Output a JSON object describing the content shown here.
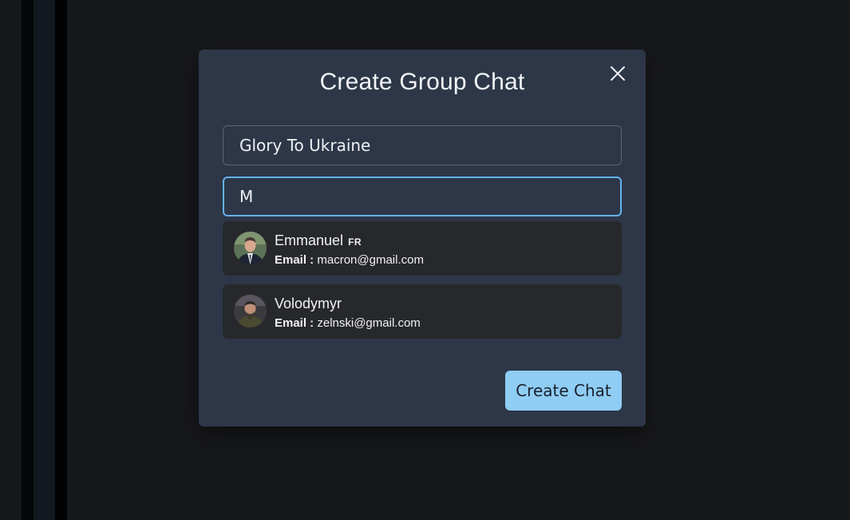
{
  "modal": {
    "title": "Create Group Chat",
    "close_icon": "close-icon"
  },
  "form": {
    "chat_name_value": "Glory To Ukraine",
    "user_search_value": "M"
  },
  "search_results": [
    {
      "name": "Emmanuel",
      "flag": "FR",
      "email_label": "Email :",
      "email": "macron@gmail.com"
    },
    {
      "name": "Volodymyr",
      "email_label": "Email :",
      "email": "zelnski@gmail.com"
    }
  ],
  "actions": {
    "create_label": "Create Chat"
  },
  "colors": {
    "modal_bg": "#2d3748",
    "accent": "#90cdf4",
    "focus_border": "#63b3ed",
    "result_bg": "#27282c",
    "page_bg": "#17181b"
  }
}
